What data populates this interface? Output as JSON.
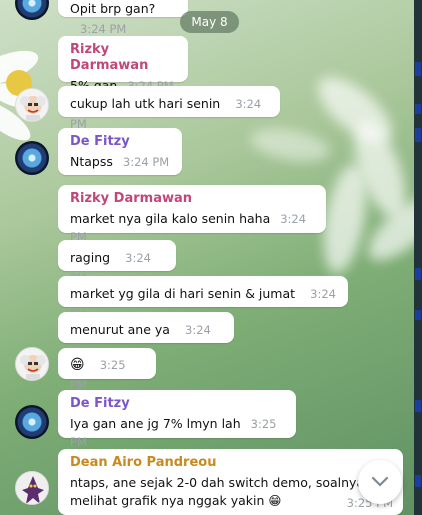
{
  "date_label": "May 8",
  "messages": [
    {
      "text": "Opit brp gan?",
      "time": "3:24 PM"
    },
    {
      "sender": "Rizky Darmawan",
      "text": "5% gan",
      "time": "3:24 PM"
    },
    {
      "text": "cukup lah utk hari senin",
      "time": "3:24 PM"
    },
    {
      "sender": "De Fitzy",
      "text": "Ntapss",
      "time": "3:24 PM"
    },
    {
      "sender": "Rizky Darmawan",
      "text": "market nya gila kalo senin haha",
      "time": "3:24 PM"
    },
    {
      "text": "raging",
      "time": "3:24 PM"
    },
    {
      "text": "market yg gila di hari senin & jumat",
      "time": "3:24 PM"
    },
    {
      "text": "menurut ane ya",
      "time": "3:24 PM"
    },
    {
      "text": "😁",
      "time": "3:25 PM"
    },
    {
      "sender": "De Fitzy",
      "text": "Iya gan ane jg 7% lmyn lah",
      "time": "3:25 PM"
    },
    {
      "sender": "Dean Airo Pandreou",
      "text_line1": "ntaps, ane sejak 2-0 dah switch demo, soalnya",
      "text_line2": "melihat grafik nya nggak yakin 😁",
      "time": "3:25 PM"
    }
  ],
  "colors": {
    "rizky": "#c2467a",
    "fitzy": "#7b56c9",
    "dean": "#c88a1e"
  }
}
